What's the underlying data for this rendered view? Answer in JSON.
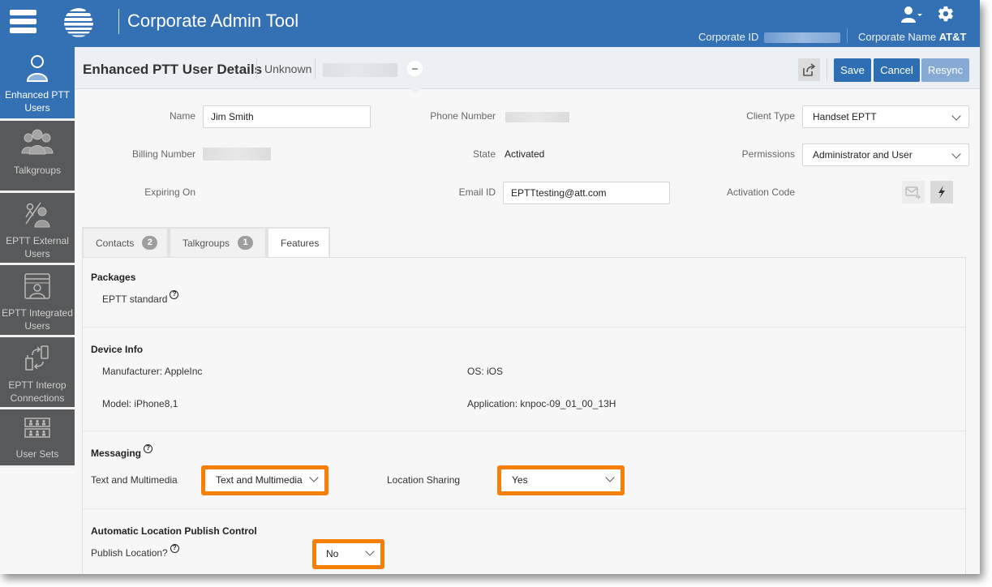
{
  "header": {
    "app_title": "Corporate Admin Tool",
    "menu_icon": "hamburger-menu-icon",
    "logo": "att-globe-logo",
    "user_icon": "user-dropdown-icon",
    "settings_icon": "gear-icon",
    "corporate_id_label": "Corporate ID",
    "corporate_name_label": "Corporate Name",
    "corporate_name_value": "AT&T",
    "brand_color": "#3470b4"
  },
  "sidebar": {
    "items": [
      {
        "label_line1": "Enhanced PTT",
        "label_line2": "Users",
        "icon": "user-icon",
        "active": true
      },
      {
        "label_line1": "Talkgroups",
        "label_line2": "",
        "icon": "group-icon",
        "active": false
      },
      {
        "label_line1": "EPTT External",
        "label_line2": "Users",
        "icon": "external-user-icon",
        "active": false
      },
      {
        "label_line1": "EPTT Integrated",
        "label_line2": "Users",
        "icon": "integrated-user-icon",
        "active": false
      },
      {
        "label_line1": "EPTT Interop",
        "label_line2": "Connections",
        "icon": "interop-icon",
        "active": false
      },
      {
        "label_line1": "User Sets",
        "label_line2": "",
        "icon": "user-sets-icon",
        "active": false
      }
    ]
  },
  "page": {
    "title": "Enhanced PTT User Details",
    "status": "Unknown",
    "buttons": {
      "save": "Save",
      "cancel": "Cancel",
      "resync": "Resync"
    }
  },
  "form": {
    "name_label": "Name",
    "name_value": "Jim Smith",
    "billing_label": "Billing Number",
    "expiring_label": "Expiring On",
    "phone_label": "Phone Number",
    "state_label": "State",
    "state_value": "Activated",
    "email_label": "Email ID",
    "email_value": "EPTTtesting@att.com",
    "client_type_label": "Client Type",
    "client_type_value": "Handset EPTT",
    "permissions_label": "Permissions",
    "permissions_value": "Administrator and User",
    "activation_label": "Activation Code"
  },
  "tabs": [
    {
      "label": "Contacts",
      "count": "2",
      "active": false
    },
    {
      "label": "Talkgroups",
      "count": "1",
      "active": false
    },
    {
      "label": "Features",
      "count": null,
      "active": true
    }
  ],
  "features": {
    "packages_title": "Packages",
    "package_name": "EPTT standard",
    "device_title": "Device Info",
    "manufacturer": "Manufacturer: AppleInc",
    "os": "OS: iOS",
    "model": "Model: iPhone8,1",
    "application": "Application: knpoc-09_01_00_13H",
    "messaging_title": "Messaging",
    "text_multimedia_label": "Text and Multimedia",
    "text_multimedia_value": "Text and Multimedia",
    "location_sharing_label": "Location Sharing",
    "location_sharing_value": "Yes",
    "alpc_title": "Automatic Location Publish Control",
    "publish_location_label": "Publish Location?",
    "publish_location_value": "No",
    "highlight_color": "#f77f06",
    "help_glyph": "?"
  }
}
